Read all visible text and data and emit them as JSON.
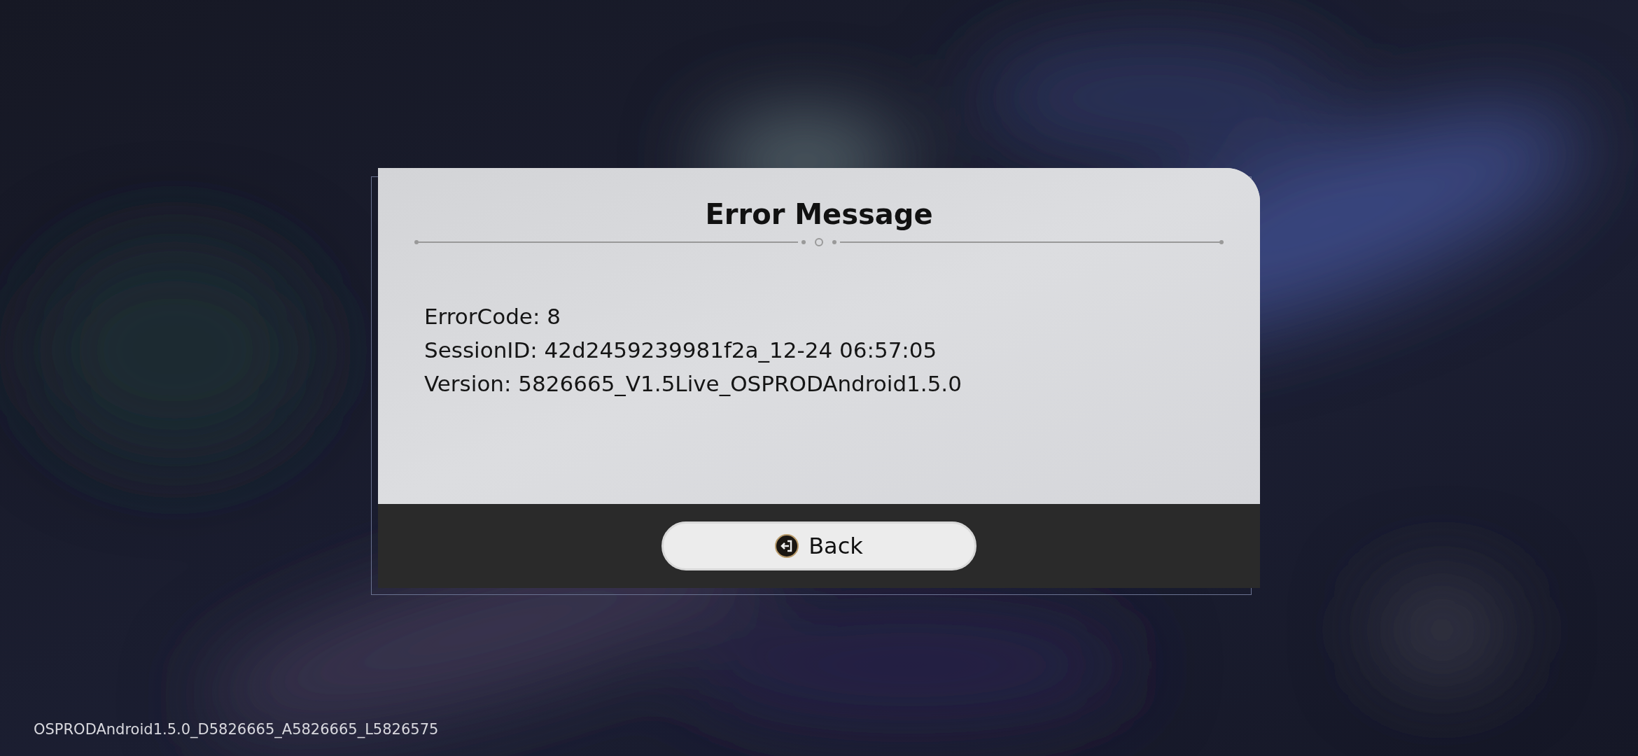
{
  "dialog": {
    "title": "Error Message",
    "lines": [
      "ErrorCode: 8",
      "SessionID: 42d2459239981f2a_12-24 06:57:05",
      "Version: 5826665_V1.5Live_OSPRODAndroid1.5.0"
    ],
    "button": "Back"
  },
  "footer": "OSPRODAndroid1.5.0_D5826665_A5826665_L5826575"
}
